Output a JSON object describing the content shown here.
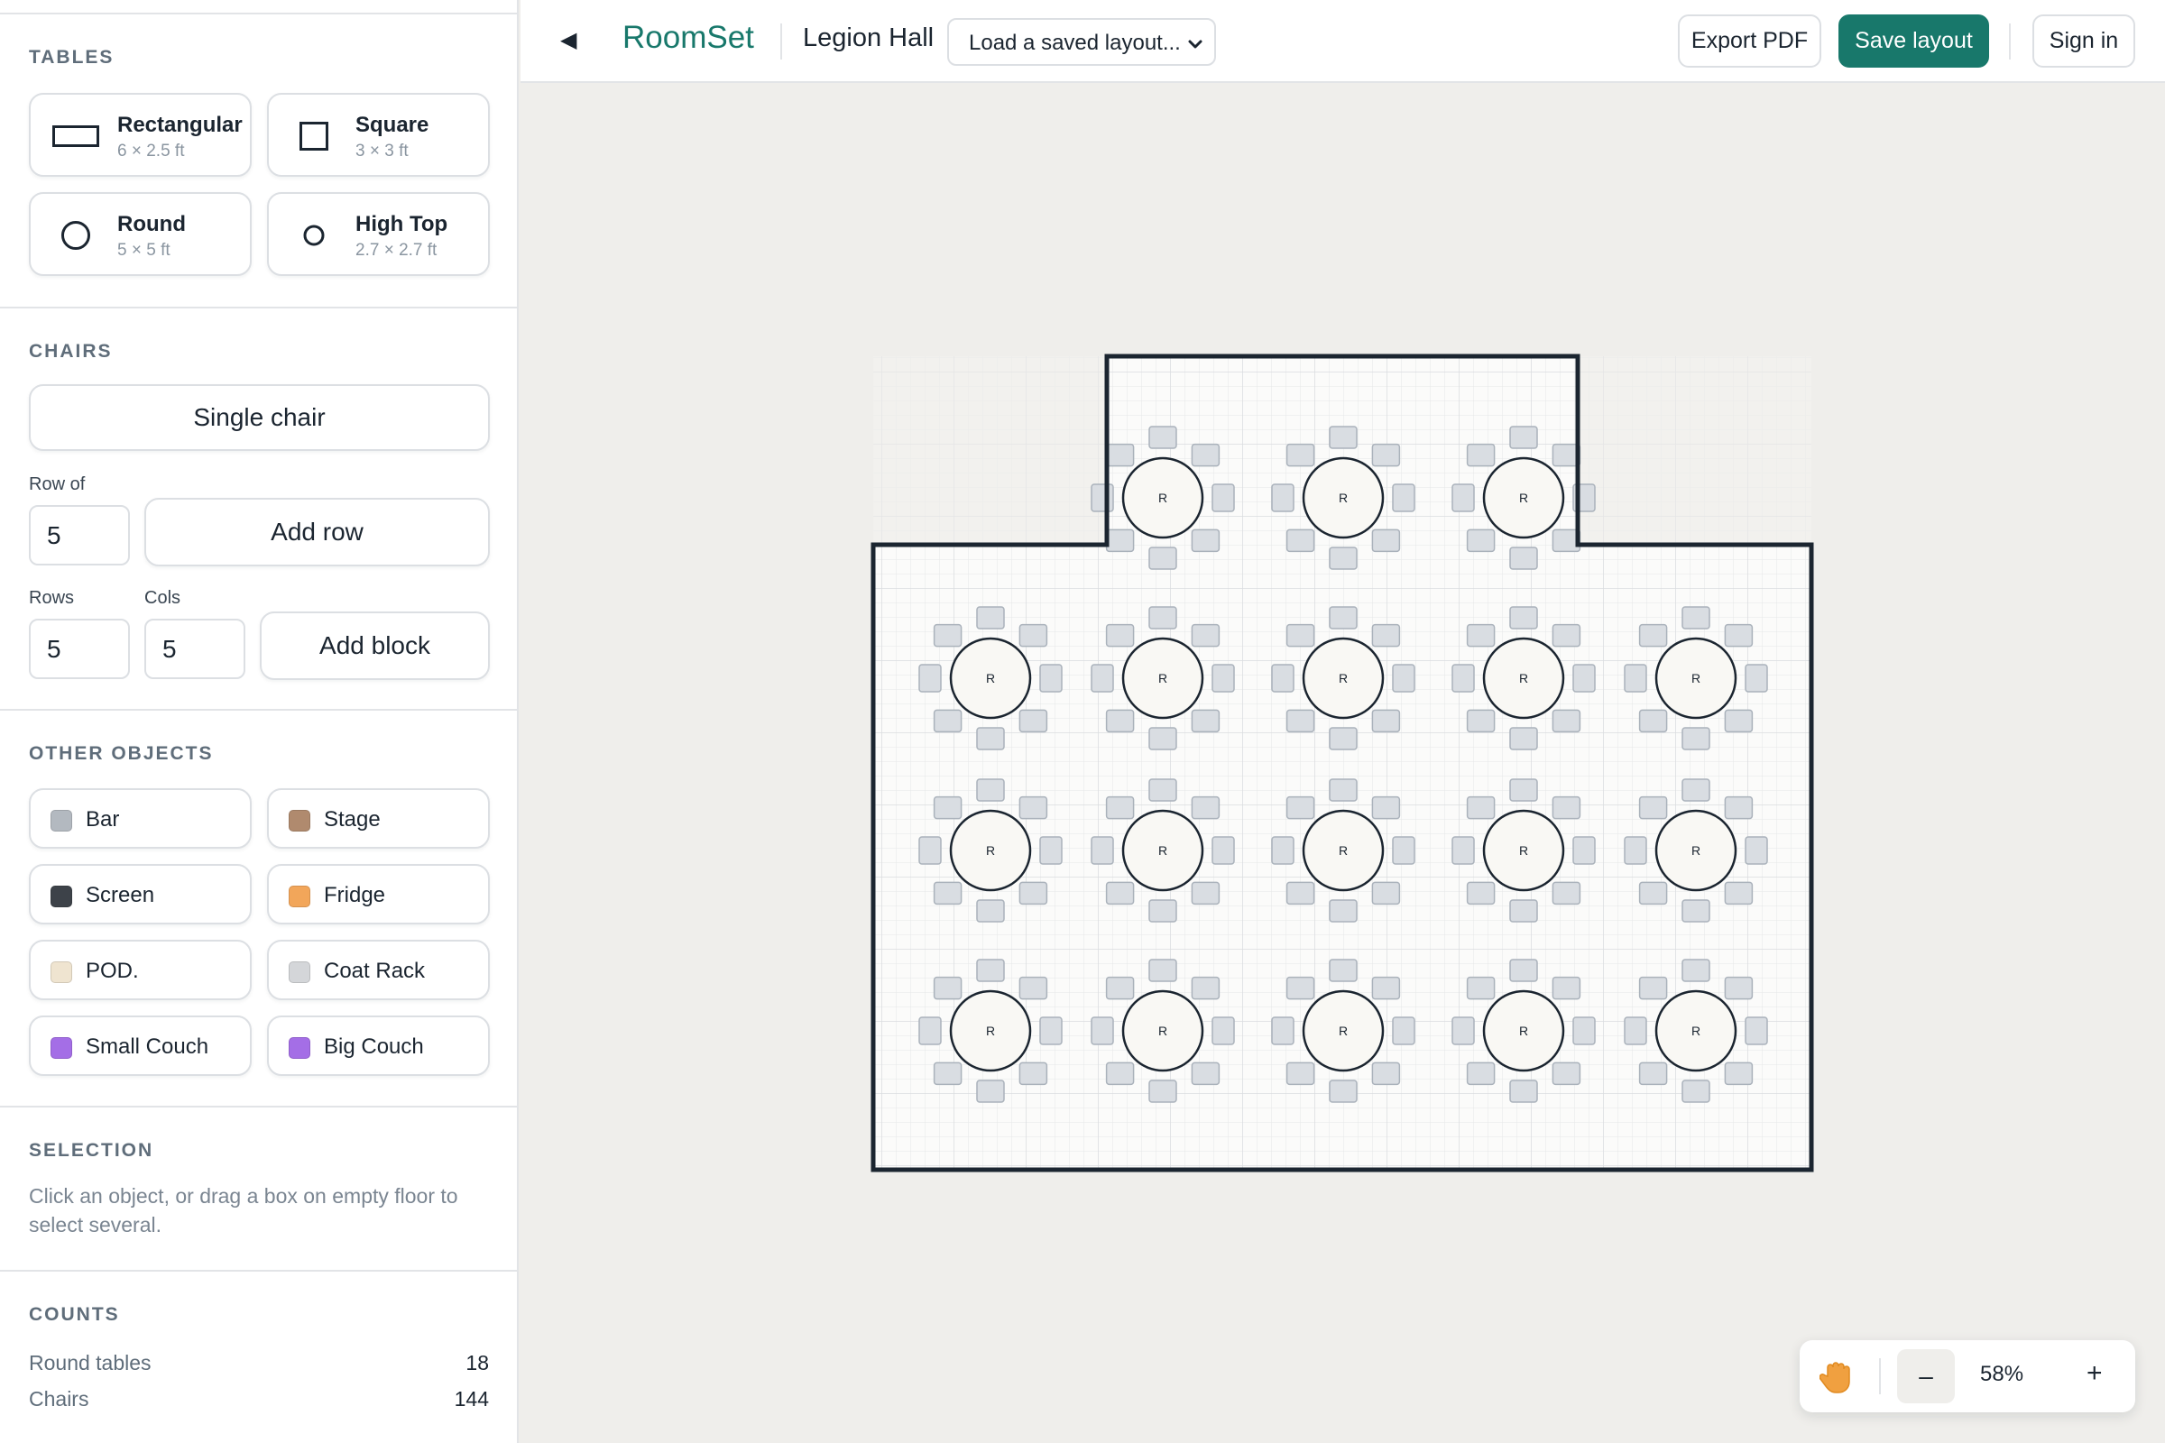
{
  "sidebar": {
    "tables": {
      "title": "TABLES",
      "items": [
        {
          "name": "Rectangular",
          "size": "6 × 2.5 ft",
          "icon": "rectangle-table-icon"
        },
        {
          "name": "Square",
          "size": "3 × 3 ft",
          "icon": "square-table-icon"
        },
        {
          "name": "Round",
          "size": "5 × 5 ft",
          "icon": "round-table-icon"
        },
        {
          "name": "High Top",
          "size": "2.7 × 2.7 ft",
          "icon": "high-top-table-icon"
        }
      ]
    },
    "chairs": {
      "title": "CHAIRS",
      "single_chair_label": "Single chair",
      "row_of_label": "Row of",
      "row_of_value": "5",
      "add_row_label": "Add row",
      "rows_label": "Rows",
      "cols_label": "Cols",
      "rows_value": "5",
      "cols_value": "5",
      "add_block_label": "Add block"
    },
    "other_objects": {
      "title": "OTHER OBJECTS",
      "items": [
        {
          "name": "Bar",
          "color": "#b3b9c0"
        },
        {
          "name": "Stage",
          "color": "#b08a6e"
        },
        {
          "name": "Screen",
          "color": "#3d4249"
        },
        {
          "name": "Fridge",
          "color": "#f2a65a"
        },
        {
          "name": "POD.",
          "color": "#efe4d0"
        },
        {
          "name": "Coat Rack",
          "color": "#d4d6d9"
        },
        {
          "name": "Small Couch",
          "color": "#a46ee6"
        },
        {
          "name": "Big Couch",
          "color": "#a46ee6"
        }
      ]
    },
    "selection": {
      "title": "SELECTION",
      "hint": "Click an object, or drag a box on empty floor to select several."
    },
    "counts": {
      "title": "COUNTS",
      "rows": [
        {
          "label": "Round tables",
          "value": "18"
        },
        {
          "label": "Chairs",
          "value": "144"
        }
      ]
    }
  },
  "header": {
    "collapse_icon": "collapse-left-icon",
    "brand": "RoomSet",
    "venue": "Legion Hall",
    "layout_select_value": "Load a saved layout...",
    "export_label": "Export PDF",
    "save_label": "Save layout",
    "signin_label": "Sign in",
    "accent_color": "#18786b"
  },
  "floor": {
    "table_label": "R",
    "table_rows": [
      3,
      5,
      5,
      5
    ],
    "chairs_per_table": 8
  },
  "zoom": {
    "pan_icon": "hand-pan-icon",
    "minus_label": "–",
    "value": "58%",
    "plus_label": "+"
  }
}
